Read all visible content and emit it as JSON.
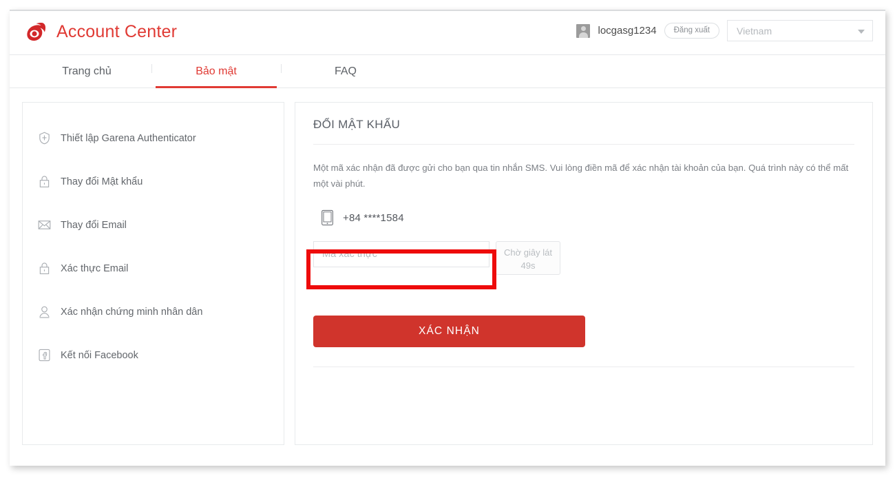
{
  "header": {
    "logo_icon": "garena-logo-icon",
    "title": "Account Center",
    "username": "locgasg1234",
    "logout_label": "Đăng xuất",
    "region_value": "Vietnam",
    "caret_icon": "chevron-down-icon",
    "avatar_icon": "avatar"
  },
  "tabs": [
    {
      "label": "Trang chủ",
      "active": false
    },
    {
      "label": "Bảo mật",
      "active": true
    },
    {
      "label": "FAQ",
      "active": false
    }
  ],
  "sidebar": {
    "items": [
      {
        "label": "Thiết lập Garena Authenticator",
        "icon": "shield-icon"
      },
      {
        "label": "Thay đổi Mật khẩu",
        "icon": "lock-icon"
      },
      {
        "label": "Thay đổi Email",
        "icon": "envelope-icon"
      },
      {
        "label": "Xác thực Email",
        "icon": "lock-icon"
      },
      {
        "label": "Xác nhận chứng minh nhân dân",
        "icon": "user-id-icon"
      },
      {
        "label": "Kết nối Facebook",
        "icon": "facebook-icon"
      }
    ]
  },
  "main": {
    "title": "ĐỔI MẬT KHẨU",
    "intro": "Một mã xác nhận đã được gửi cho bạn qua tin nhắn SMS. Vui lòng điền mã để xác nhận tài khoản của bạn. Quá trình này có thể mất một vài phút.",
    "phone": {
      "icon": "mobile-device-icon",
      "number": "+84 ****1584"
    },
    "code_input": {
      "placeholder": "Mã xác thực",
      "value": ""
    },
    "resend_button": {
      "label": "Chờ giây lát",
      "countdown": "49s"
    },
    "submit_label": "XÁC NHẬN"
  },
  "colors": {
    "brand_red": "#e03a34",
    "button_red": "#d0342c",
    "annotation_red": "#ee0b0b",
    "text_gray": "#62666b"
  }
}
